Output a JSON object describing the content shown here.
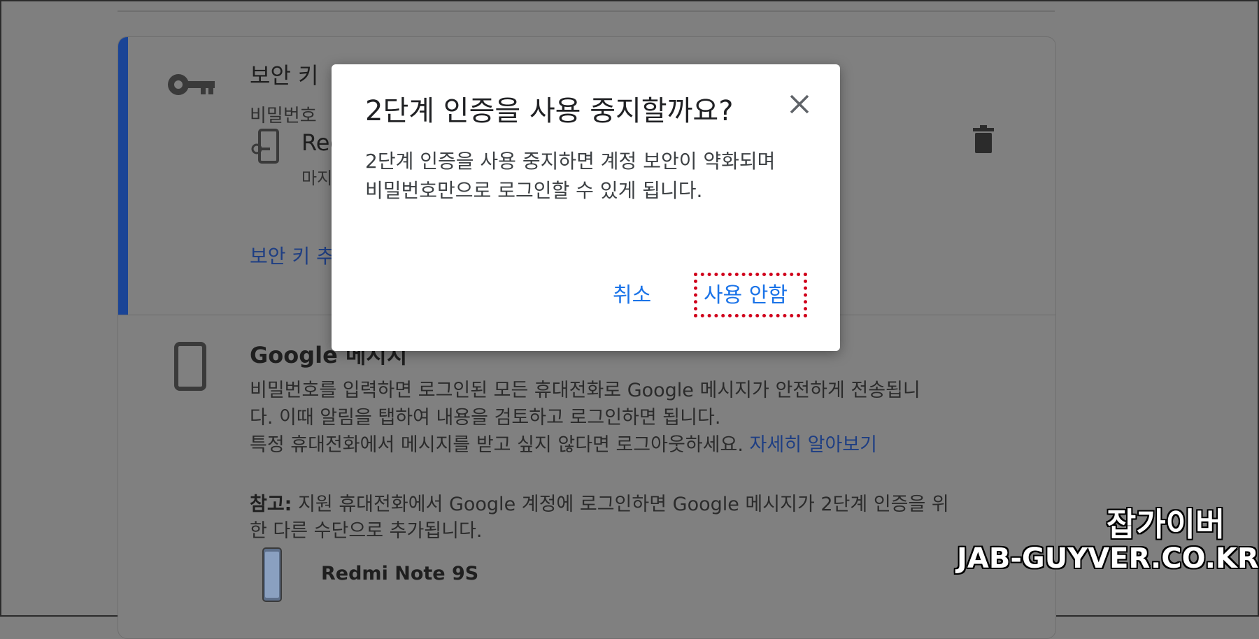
{
  "security_key": {
    "title": "보안 키",
    "subtitle": "비밀번호",
    "device_name": "Red",
    "device_meta": "마지",
    "add_link": "보안 키 추"
  },
  "google_message": {
    "title": "Google 메시지",
    "body_line1": "비밀번호를 입력하면 로그인된 모든 휴대전화로 Google 메시지가 안전하게 전송됩니",
    "body_line2": "다. 이때 알림을 탭하여 내용을 검토하고 로그인하면 됩니다.",
    "body_line3": "특정 휴대전화에서 메시지를 받고 싶지 않다면 로그아웃하세요.",
    "learn_more": "자세히 알아보기",
    "note_label": "참고:",
    "note_line1": "지원 휴대전화에서 Google 계정에 로그인하면 Google 메시지가 2단계 인증을 위",
    "note_line2": "한 다른 수단으로 추가됩니다.",
    "device": "Redmi Note 9S"
  },
  "dialog": {
    "title": "2단계 인증을 사용 중지할까요?",
    "body": "2단계 인증을 사용 중지하면 계정 보안이 약화되며 비밀번호만으로 로그인할 수 있게 됩니다.",
    "cancel_label": "취소",
    "confirm_label": "사용 안함"
  },
  "watermark": {
    "kr": "잡가이버",
    "en": "JAB-GUYVER.CO.KR"
  },
  "colors": {
    "accent": "#1a73e8",
    "highlight": "#d0021b",
    "card_accent": "#1a4496"
  }
}
